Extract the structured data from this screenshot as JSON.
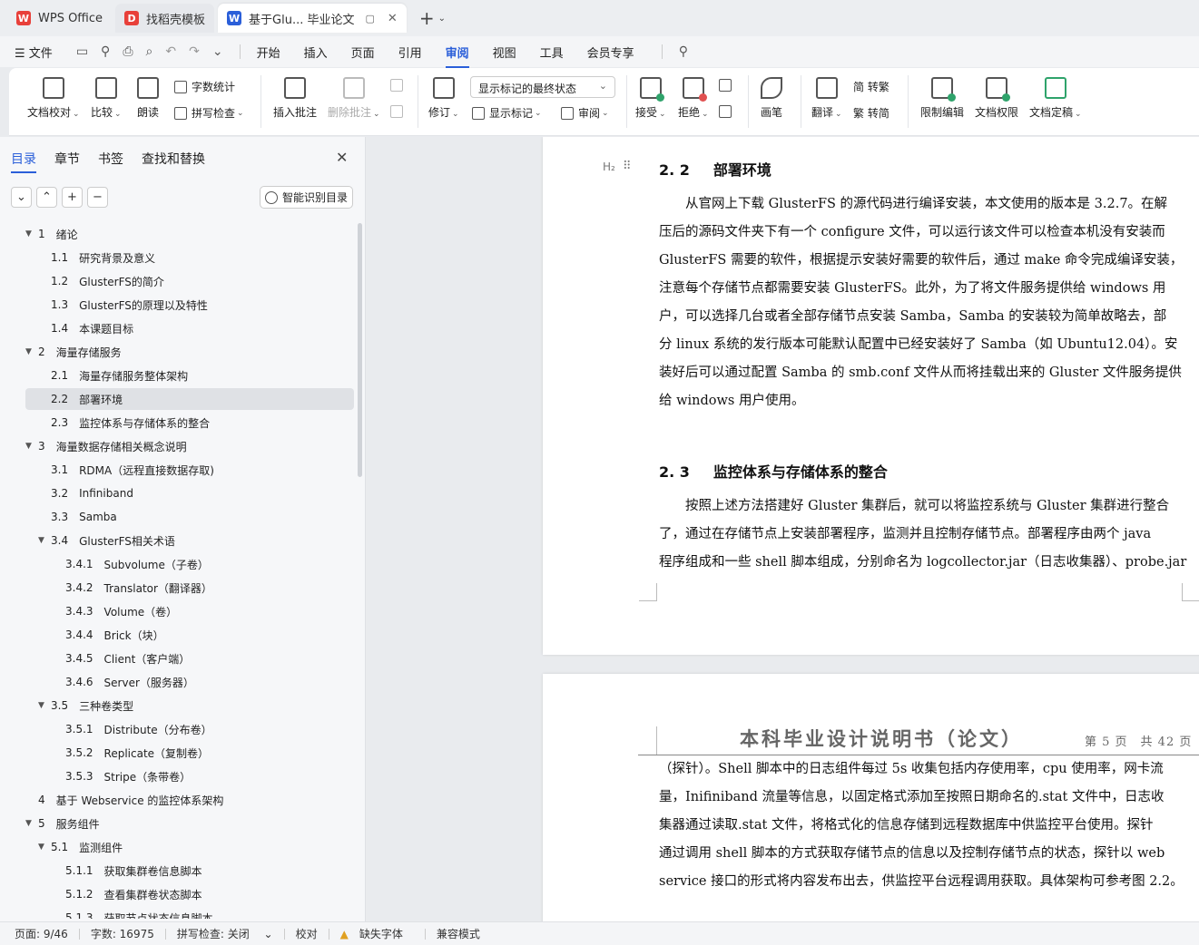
{
  "tabs": [
    {
      "label": "WPS Office",
      "logo": "W"
    },
    {
      "label": "找稻壳模板",
      "logo": "D"
    },
    {
      "label": "基于Glu... 毕业论文",
      "logo": "W"
    }
  ],
  "menu": {
    "file": "文件",
    "items": [
      "开始",
      "插入",
      "页面",
      "引用",
      "审阅",
      "视图",
      "工具",
      "会员专享"
    ],
    "active": "审阅"
  },
  "ribbon": {
    "doc_check": "文档校对",
    "compare": "比较",
    "read_aloud": "朗读",
    "word_count": "字数统计",
    "spell_check": "拼写检查",
    "insert_comment": "插入批注",
    "delete_comment": "删除批注",
    "revise": "修订",
    "markup_state": "显示标记的最终状态",
    "show_markup": "显示标记",
    "review": "审阅",
    "accept": "接受",
    "reject": "拒绝",
    "pen": "画笔",
    "translate": "翻译",
    "to_traditional": "简 转繁",
    "to_simplified": "繁 转简",
    "restrict_edit": "限制编辑",
    "doc_permission": "文档权限",
    "doc_finalize": "文档定稿"
  },
  "nav": {
    "tabs": [
      "目录",
      "章节",
      "书签",
      "查找和替换"
    ],
    "smart_toc": "智能识别目录",
    "toc": [
      {
        "num": "1",
        "label": "绪论",
        "level": 1,
        "tw": "▼"
      },
      {
        "num": "1.1",
        "label": "研究背景及意义",
        "level": 2
      },
      {
        "num": "1.2",
        "label": "GlusterFS的简介",
        "level": 2
      },
      {
        "num": "1.3",
        "label": "GlusterFS的原理以及特性",
        "level": 2
      },
      {
        "num": "1.4",
        "label": "本课题目标",
        "level": 2
      },
      {
        "num": "2",
        "label": "海量存储服务",
        "level": 1,
        "tw": "▼"
      },
      {
        "num": "2.1",
        "label": "海量存储服务整体架构",
        "level": 2
      },
      {
        "num": "2.2",
        "label": "部署环境",
        "level": 2,
        "selected": true
      },
      {
        "num": "2.3",
        "label": "监控体系与存储体系的整合",
        "level": 2
      },
      {
        "num": "3",
        "label": "海量数据存储相关概念说明",
        "level": 1,
        "tw": "▼"
      },
      {
        "num": "3.1",
        "label": "RDMA（远程直接数据存取)",
        "level": 2
      },
      {
        "num": "3.2",
        "label": "Infiniband",
        "level": 2
      },
      {
        "num": "3.3",
        "label": "Samba",
        "level": 2
      },
      {
        "num": "3.4",
        "label": "GlusterFS相关术语",
        "level": 2,
        "tw": "▼"
      },
      {
        "num": "3.4.1",
        "label": "Subvolume（子卷）",
        "level": 3
      },
      {
        "num": "3.4.2",
        "label": "Translator（翻译器）",
        "level": 3
      },
      {
        "num": "3.4.3",
        "label": "Volume（卷）",
        "level": 3
      },
      {
        "num": "3.4.4",
        "label": "Brick（块）",
        "level": 3
      },
      {
        "num": "3.4.5",
        "label": "Client（客户端）",
        "level": 3
      },
      {
        "num": "3.4.6",
        "label": "Server（服务器）",
        "level": 3
      },
      {
        "num": "3.5",
        "label": "三种卷类型",
        "level": 2,
        "tw": "▼"
      },
      {
        "num": "3.5.1",
        "label": "Distribute（分布卷）",
        "level": 3
      },
      {
        "num": "3.5.2",
        "label": "Replicate（复制卷）",
        "level": 3
      },
      {
        "num": "3.5.3",
        "label": "Stripe（条带卷）",
        "level": 3
      },
      {
        "num": "4",
        "label": "基于 Webservice 的监控体系架构",
        "level": 1
      },
      {
        "num": "5",
        "label": "服务组件",
        "level": 1,
        "tw": "▼"
      },
      {
        "num": "5.1",
        "label": "监测组件",
        "level": 2,
        "tw": "▼"
      },
      {
        "num": "5.1.1",
        "label": "获取集群卷信息脚本",
        "level": 3
      },
      {
        "num": "5.1.2",
        "label": "查看集群卷状态脚本",
        "level": 3
      },
      {
        "num": "5.1.3",
        "label": "获取节点状态信息脚本",
        "level": 3
      }
    ]
  },
  "doc": {
    "heading_marker": "H₂",
    "sec22": {
      "num": "2. 2",
      "title": "部署环境"
    },
    "para22": [
      "　　从官网上下载 GlusterFS 的源代码进行编译安装，本文使用的版本是 3.2.7。在解",
      "压后的源码文件夹下有一个 configure 文件，可以运行该文件可以检查本机没有安装而",
      "GlusterFS 需要的软件，根据提示安装好需要的软件后，通过 make 命令完成编译安装，",
      "注意每个存储节点都需要安装 GlusterFS。此外，为了将文件服务提供给 windows 用",
      "户，可以选择几台或者全部存储节点安装 Samba，Samba 的安装较为简单故略去，部",
      "分 linux 系统的发行版本可能默认配置中已经安装好了 Samba（如 Ubuntu12.04）。安",
      "装好后可以通过配置 Samba 的 smb.conf 文件从而将挂载出来的 Gluster 文件服务提供",
      "给 windows 用户使用。"
    ],
    "sec23": {
      "num": "2. 3",
      "title": "监控体系与存储体系的整合"
    },
    "para23": [
      "　　按照上述方法搭建好 Gluster 集群后，就可以将监控系统与 Gluster 集群进行整合",
      "了，通过在存储节点上安装部署程序，监测并且控制存储节点。部署程序由两个 java",
      "程序组成和一些 shell 脚本组成，分别命名为 logcollector.jar（日志收集器）、probe.jar"
    ],
    "header_title": "本科毕业设计说明书（论文）",
    "header_page": "第 5 页　共 42 页",
    "para_p2": [
      "（探针）。Shell 脚本中的日志组件每过 5s 收集包括内存使用率，cpu 使用率，网卡流",
      "量，Inifiniband 流量等信息，以固定格式添加至按照日期命名的.stat 文件中，日志收",
      "集器通过读取.stat 文件，将格式化的信息存储到远程数据库中供监控平台使用。探针",
      "通过调用 shell 脚本的方式获取存储节点的信息以及控制存储节点的状态，探针以 web",
      "service 接口的形式将内容发布出去，供监控平台远程调用获取。具体架构可参考图 2.2。"
    ]
  },
  "status": {
    "page": "页面: 9/46",
    "words": "字数: 16975",
    "spell": "拼写检查: 关闭",
    "proof": "校对",
    "missing_font": "缺失字体",
    "compat": "兼容模式"
  }
}
